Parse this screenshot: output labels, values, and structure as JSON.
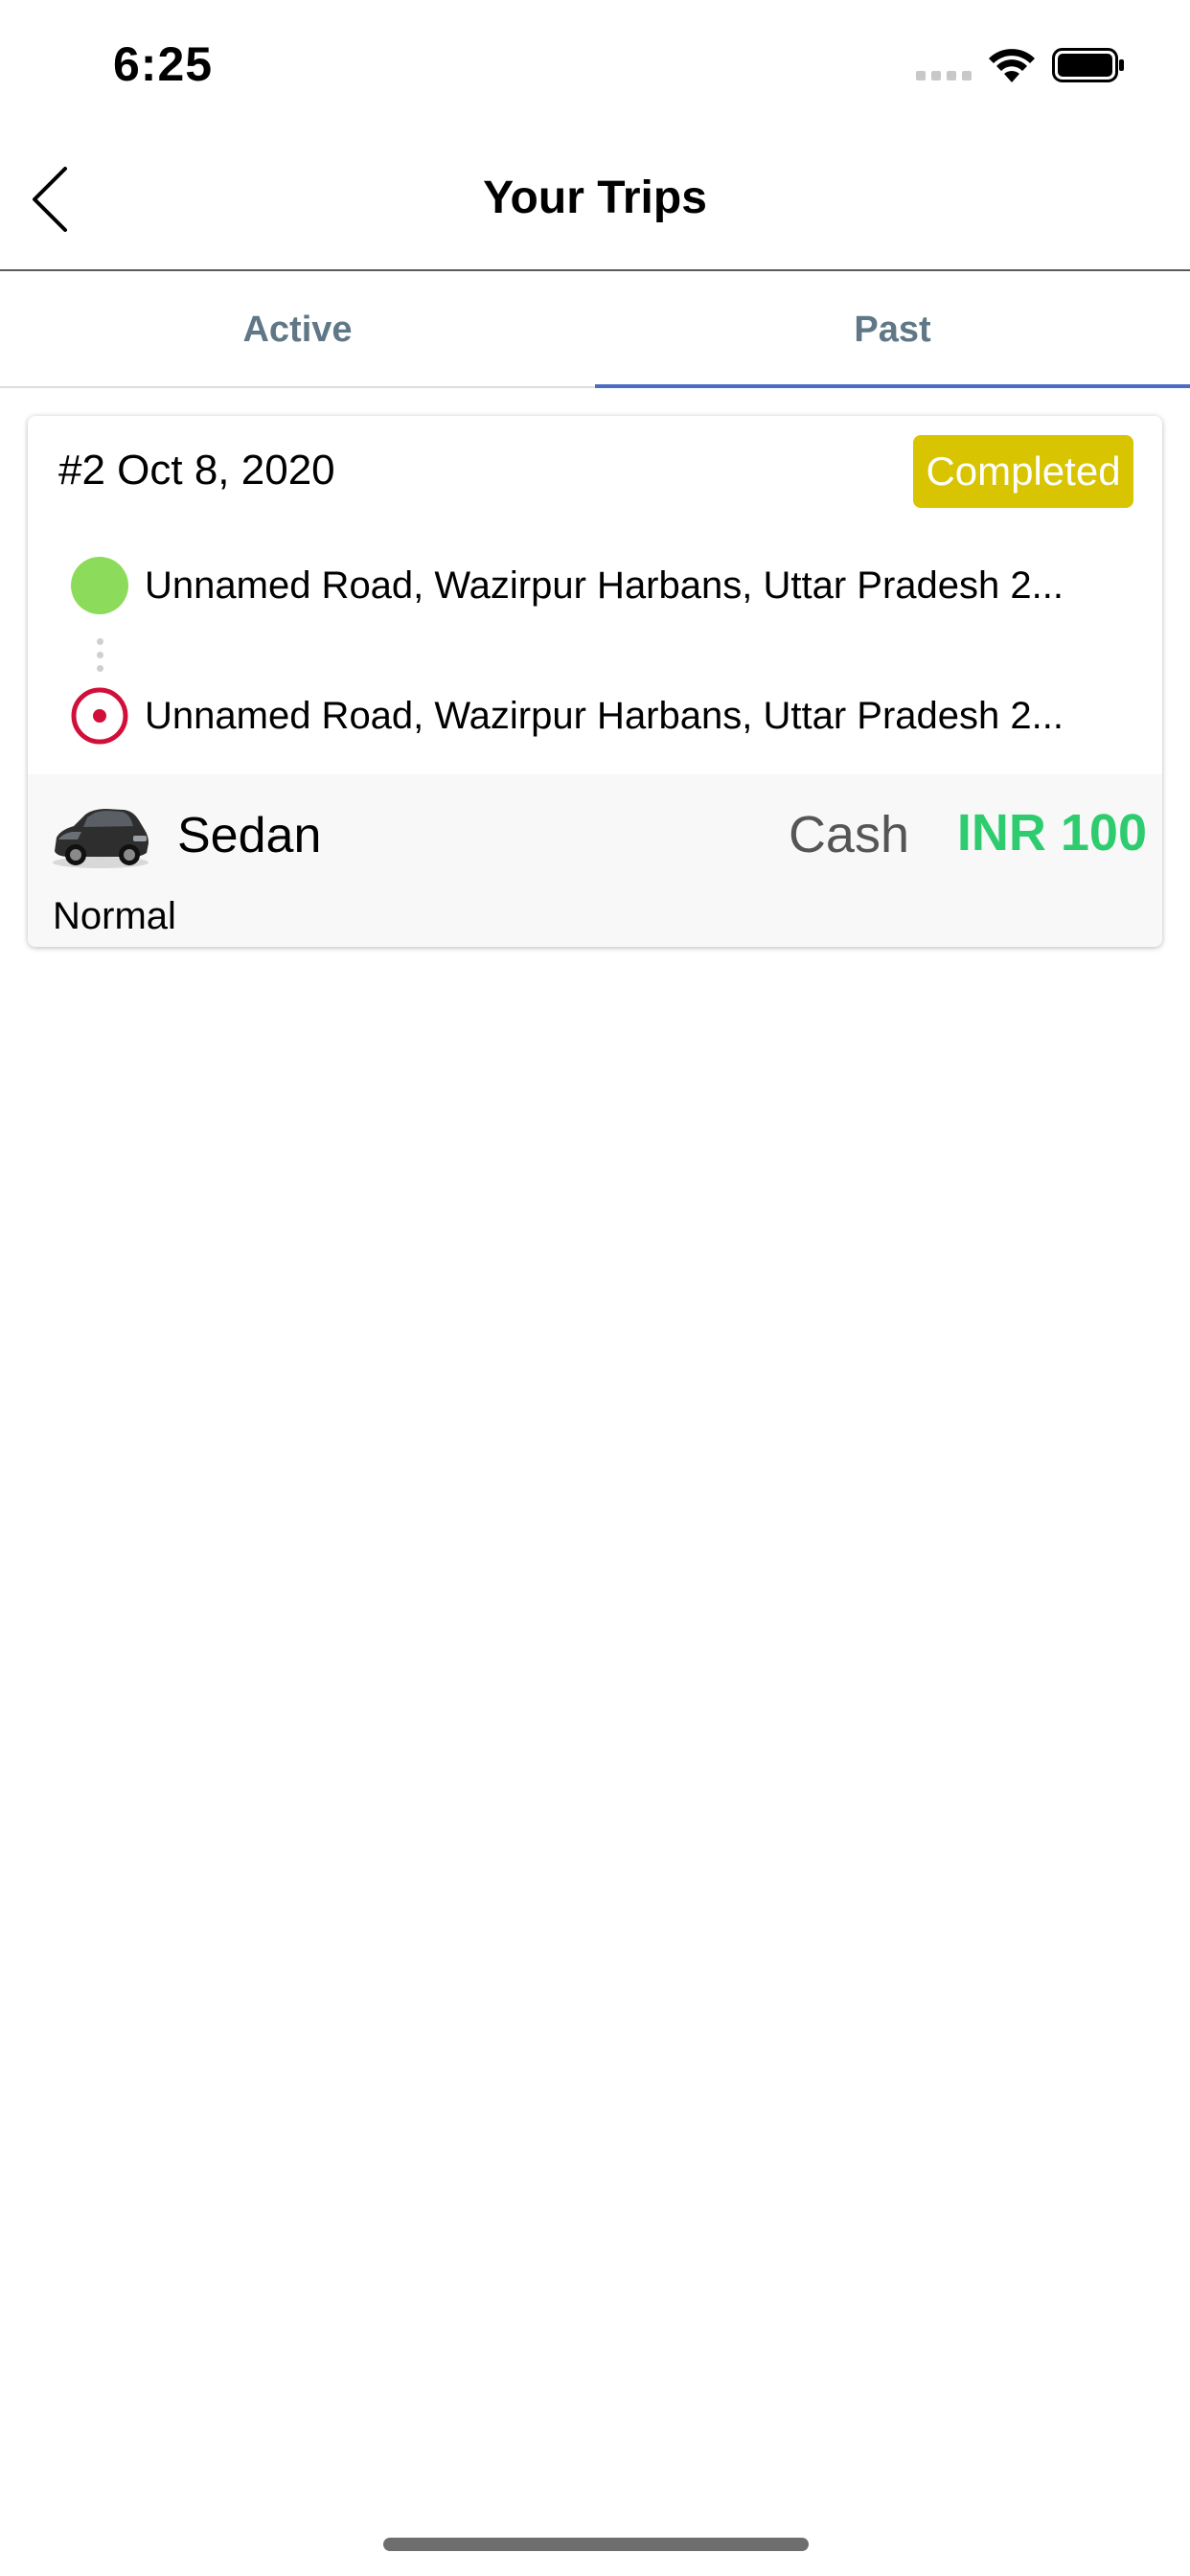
{
  "status_bar": {
    "time": "6:25"
  },
  "nav": {
    "title": "Your Trips"
  },
  "tabs": [
    {
      "label": "Active",
      "active": false
    },
    {
      "label": "Past",
      "active": true
    }
  ],
  "trip": {
    "id_date": "#2 Oct 8, 2020",
    "status": "Completed",
    "pickup_address": "Unnamed Road, Wazirpur Harbans, Uttar Pradesh 2...",
    "drop_address": "Unnamed Road, Wazirpur Harbans, Uttar Pradesh 2...",
    "vehicle": "Sedan",
    "payment_method": "Cash",
    "fare": "INR 100",
    "ride_type": "Normal"
  },
  "colors": {
    "status_completed": "#d8c400",
    "fare": "#2ecc6f",
    "tab_indicator": "#4b6cc1",
    "pickup_marker": "#8cdb5a",
    "drop_marker": "#d0103a"
  },
  "icons": {
    "back": "chevron-left-icon",
    "pickup": "green-dot-icon",
    "drop": "target-icon",
    "car": "car-image"
  }
}
